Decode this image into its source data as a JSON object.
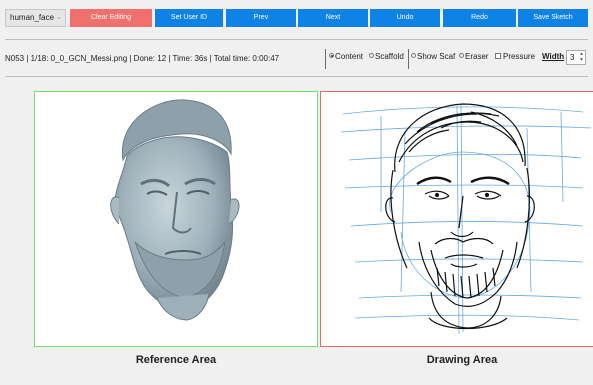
{
  "toolbar": {
    "category": "human_face",
    "buttons": {
      "clear": "Clear Editing",
      "set_user": "Set User ID",
      "prev": "Prev",
      "next": "Next",
      "undo": "Undo",
      "redo": "Redo",
      "save": "Save Sketch"
    },
    "colors": {
      "primary": "#0f82e6",
      "danger": "#f0706e"
    }
  },
  "status": {
    "text": "N053 | 1/18: 0_0_GCN_Messi.png | Done: 12 | Time: 36s | Total time: 0:00:47"
  },
  "options": {
    "mode_content": "Content",
    "mode_scaffold": "Scaffold",
    "selected_mode": "Content",
    "show_scaf": "Show Scaf",
    "eraser": "Eraser",
    "pressure": "Pressure",
    "width_label": "Width",
    "width_value": "3"
  },
  "panels": {
    "reference_caption": "Reference Area",
    "drawing_caption": "Drawing Area",
    "reference_border": "#6ee06e",
    "drawing_border": "#e06b6b"
  },
  "icons": {
    "dropdown": "chevron-down-icon",
    "spinner": "spin-arrows-icon"
  }
}
